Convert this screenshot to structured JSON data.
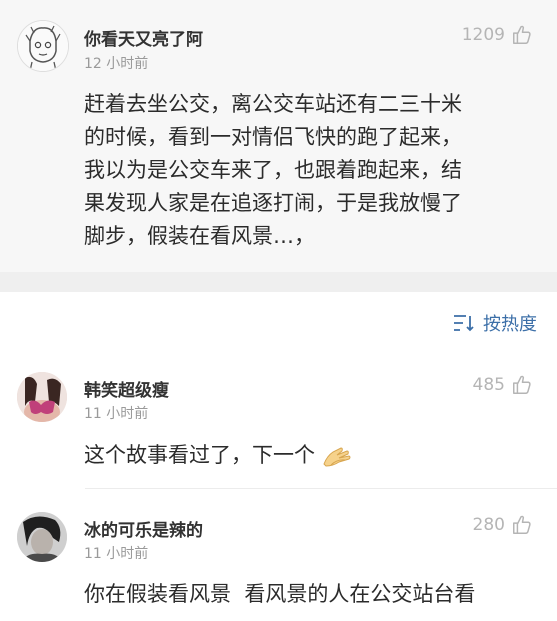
{
  "main_comment": {
    "username": "你看天又亮了阿",
    "time": "12 小时前",
    "likes": "1209",
    "lines": [
      "赶着去坐公交，离公交车站还有二三十米",
      "的时候，看到一对情侣飞快的跑了起来，",
      "我以为是公交车来了，也跟着跑起来，结",
      "果发现人家是在追逐打闹，于是我放慢了",
      "脚步，假装在看风景…，"
    ]
  },
  "sort": {
    "label": "按热度"
  },
  "replies": [
    {
      "username": "韩笑超级瘦",
      "time": "11 小时前",
      "likes": "485",
      "text": "这个故事看过了，下一个",
      "emoji": "clapping-hands-emoji"
    },
    {
      "username": "冰的可乐是辣的",
      "time": "11 小时前",
      "likes": "280",
      "text": "你在假装看风景  看风景的人在公交站台看"
    }
  ],
  "colors": {
    "link": "#3c6fa8",
    "muted": "#9a9a9a",
    "likes": "#b5b5b5",
    "highlight_bg": "#f7f7f7"
  }
}
